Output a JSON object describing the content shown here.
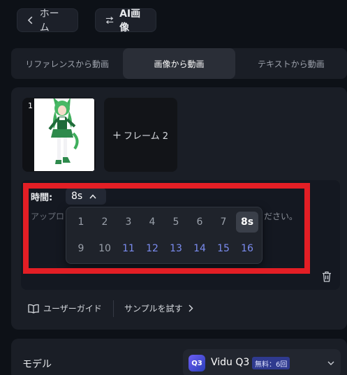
{
  "nav": {
    "home_label": "ホーム",
    "ai_label": "AI画像"
  },
  "tabs": [
    {
      "label": "リファレンスから動画",
      "active": false
    },
    {
      "label": "画像から動画",
      "active": true
    },
    {
      "label": "テキストから動画",
      "active": false
    }
  ],
  "frames": {
    "frame1_index": "1",
    "frame2_label": "フレーム 2"
  },
  "duration": {
    "label": "時間:",
    "selected": "8s",
    "options": [
      [
        "1",
        "2",
        "3",
        "4",
        "5",
        "6",
        "7",
        "8s"
      ],
      [
        "9",
        "10",
        "11",
        "12",
        "13",
        "14",
        "15",
        "16"
      ]
    ]
  },
  "prompt": {
    "placeholder_start": "アップロ",
    "placeholder_end": "ださい。"
  },
  "links": {
    "guide": "ユーザーガイド",
    "sample": "サンプルを試す"
  },
  "model": {
    "label": "モデル",
    "logo_text": "Q3",
    "name": "Vidu Q3",
    "badge": "無料：6回"
  },
  "colors": {
    "accent_blue": "#7b8cf0",
    "highlight_red": "#e31e25"
  }
}
